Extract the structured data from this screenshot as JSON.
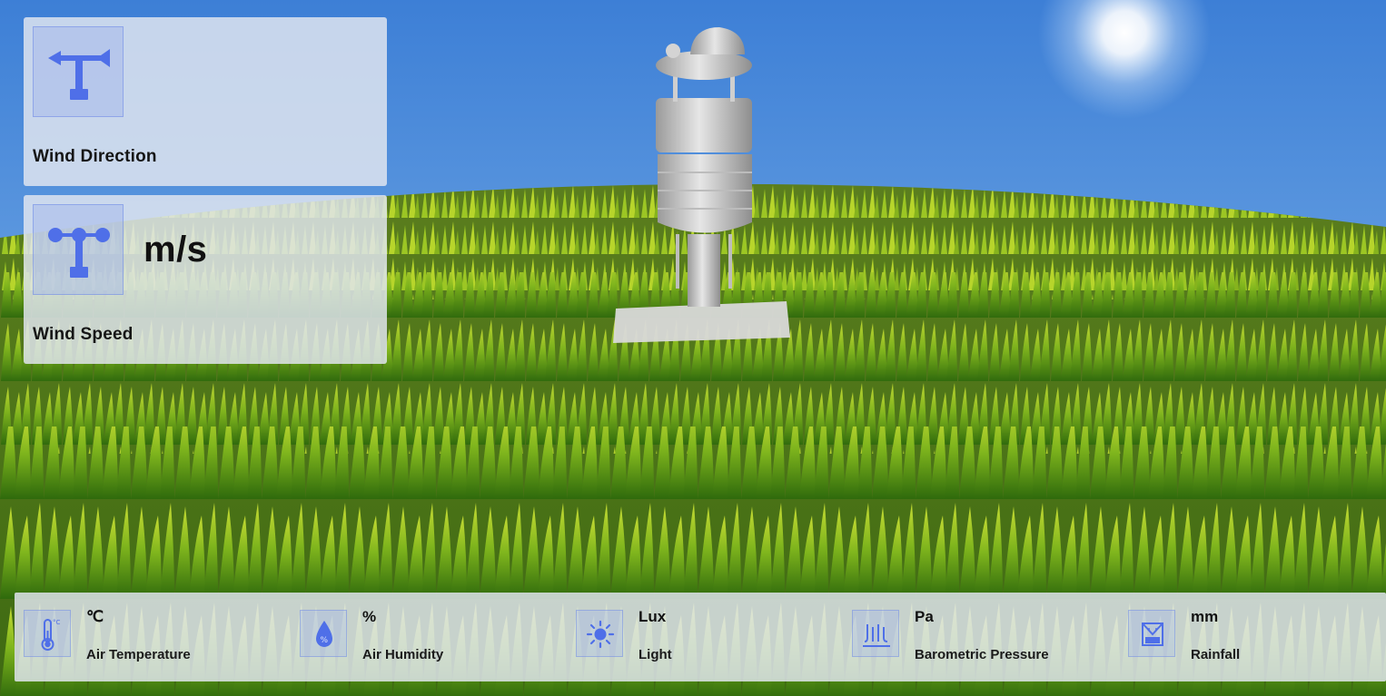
{
  "colors": {
    "accent": "#4f6fe8",
    "panel": "rgba(225,230,240,0.84)",
    "sky_top": "#3d7fd6",
    "sky_bottom": "#8fc0ec",
    "grass_dark": "#3f6e12",
    "grass_light": "#b9d62a"
  },
  "wind_direction": {
    "label": "Wind Direction",
    "icon": "wind-vane-icon"
  },
  "wind_speed": {
    "unit": "m/s",
    "label": "Wind Speed",
    "icon": "anemometer-icon"
  },
  "sensors": [
    {
      "unit": "℃",
      "label": "Air Temperature",
      "icon": "thermometer-icon"
    },
    {
      "unit": "%",
      "label": "Air Humidity",
      "icon": "humidity-drop-icon"
    },
    {
      "unit": "Lux",
      "label": "Light",
      "icon": "sun-icon"
    },
    {
      "unit": "Pa",
      "label": "Barometric Pressure",
      "icon": "pressure-icon"
    },
    {
      "unit": "mm",
      "label": "Rainfall",
      "icon": "rain-gauge-icon"
    }
  ]
}
